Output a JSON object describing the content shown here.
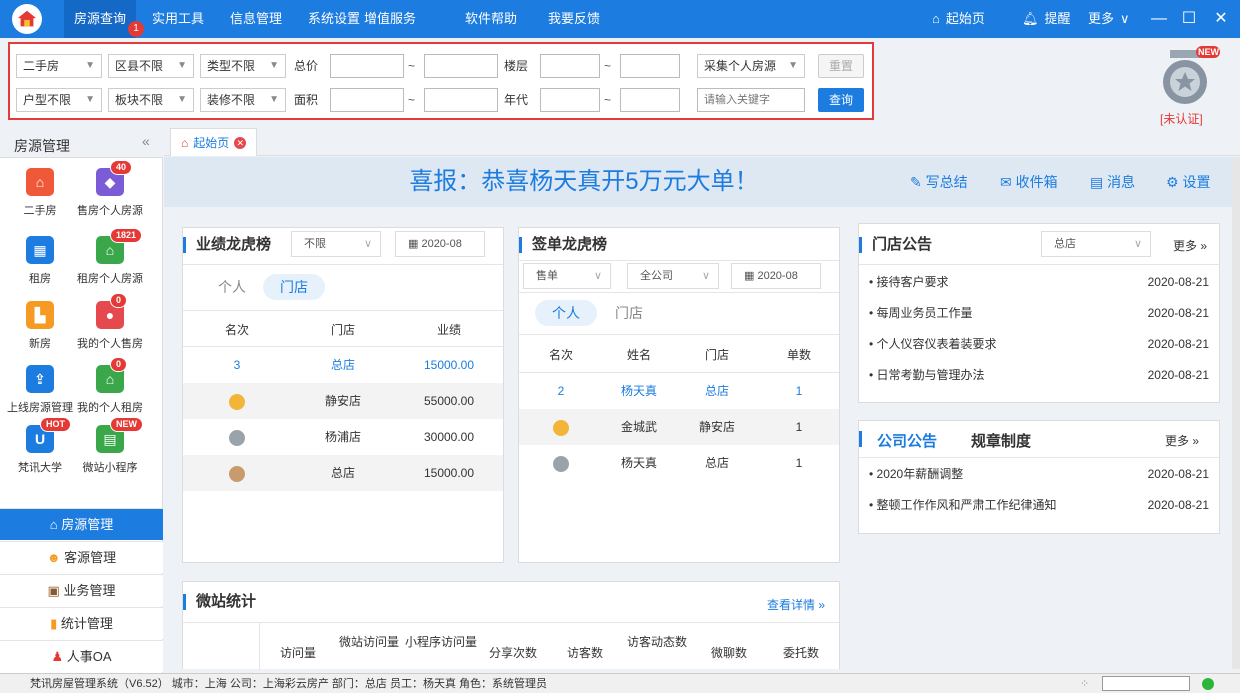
{
  "topbar": {
    "menu": [
      "房源查询",
      "实用工具",
      "信息管理",
      "系统设置",
      "增值服务",
      "软件帮助",
      "我要反馈"
    ],
    "menu_badge": "1",
    "home": "起始页",
    "remind": "提醒",
    "more": "更多"
  },
  "filter": {
    "row1": {
      "sel1": "二手房",
      "sel2": "区县不限",
      "sel3": "类型不限",
      "label1": "总价",
      "label2": "楼层",
      "sel4": "采集个人房源",
      "reset": "重置"
    },
    "row2": {
      "sel1": "户型不限",
      "sel2": "板块不限",
      "sel3": "装修不限",
      "label1": "面积",
      "label2": "年代",
      "keyword_placeholder": "请输入关键字",
      "query": "查询"
    },
    "tilde": "~"
  },
  "cert": {
    "new": "NEW",
    "status": "[未认证]"
  },
  "sidebar": {
    "title": "房源管理",
    "apps": [
      {
        "label": "二手房",
        "badge": ""
      },
      {
        "label": "售房个人房源",
        "badge": "40"
      },
      {
        "label": "租房",
        "badge": ""
      },
      {
        "label": "租房个人房源",
        "badge": "1821"
      },
      {
        "label": "新房",
        "badge": ""
      },
      {
        "label": "我的个人售房",
        "badge": "0"
      },
      {
        "label": "上线房源管理",
        "badge": ""
      },
      {
        "label": "我的个人租房",
        "badge": "0"
      },
      {
        "label": "梵讯大学",
        "badge": "HOT"
      },
      {
        "label": "微站小程序",
        "badge": "NEW"
      }
    ],
    "nav": [
      "房源管理",
      "客源管理",
      "业务管理",
      "统计管理",
      "人事OA"
    ]
  },
  "tabs": {
    "home": "起始页"
  },
  "banner": {
    "text": "喜报：恭喜杨天真开5万元大单！",
    "write": "写总结",
    "inbox": "收件箱",
    "msg": "消息",
    "settings": "设置"
  },
  "perf": {
    "title": "业绩龙虎榜",
    "filter": "不限",
    "date": "2020-08",
    "seg1": "个人",
    "seg2": "门店",
    "headers": [
      "名次",
      "门店",
      "业绩"
    ],
    "rows": [
      {
        "rank": "3",
        "store": "总店",
        "amount": "15000.00"
      },
      {
        "rank": "",
        "store": "静安店",
        "amount": "55000.00"
      },
      {
        "rank": "",
        "store": "杨浦店",
        "amount": "30000.00"
      },
      {
        "rank": "",
        "store": "总店",
        "amount": "15000.00"
      }
    ]
  },
  "sign": {
    "title": "签单龙虎榜",
    "type": "售单",
    "scope": "全公司",
    "date": "2020-08",
    "seg1": "个人",
    "seg2": "门店",
    "headers": [
      "名次",
      "姓名",
      "门店",
      "单数"
    ],
    "rows": [
      {
        "rank": "2",
        "name": "杨天真",
        "store": "总店",
        "count": "1"
      },
      {
        "rank": "",
        "name": "金城武",
        "store": "静安店",
        "count": "1"
      },
      {
        "rank": "",
        "name": "杨天真",
        "store": "总店",
        "count": "1"
      }
    ]
  },
  "store_notice": {
    "title": "门店公告",
    "scope": "总店",
    "more": "更多",
    "items": [
      {
        "text": "• 接待客户要求",
        "date": "2020-08-21"
      },
      {
        "text": "• 每周业务员工作量",
        "date": "2020-08-21"
      },
      {
        "text": "• 个人仪容仪表着装要求",
        "date": "2020-08-21"
      },
      {
        "text": "• 日常考勤与管理办法",
        "date": "2020-08-21"
      }
    ]
  },
  "company_notice": {
    "tab1": "公司公告",
    "tab2": "规章制度",
    "more": "更多",
    "items": [
      {
        "text": "• 2020年薪酬调整",
        "date": "2020-08-21"
      },
      {
        "text": "• 整顿工作作风和严肃工作纪律通知",
        "date": "2020-08-21"
      }
    ]
  },
  "wz": {
    "title": "微站统计",
    "detail": "查看详情",
    "headers": [
      "访问量",
      "微站访问量",
      "小程序访问量",
      "分享次数",
      "访客数",
      "访客动态数",
      "微聊数",
      "委托数"
    ]
  },
  "status": "梵讯房屋管理系统（V6.52） 城市：上海  公司：上海彩云房产  部门：总店  员工：杨天真  角色：系统管理员",
  "colors": {
    "primary": "#1c7ce0",
    "alert": "#e53935"
  }
}
